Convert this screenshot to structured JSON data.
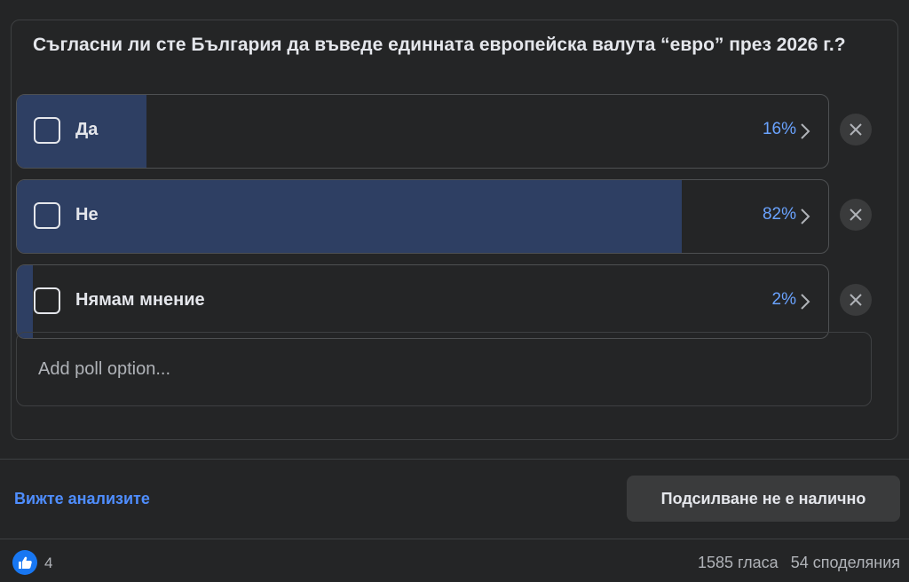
{
  "poll": {
    "question": "Съгласни ли сте България да въведе единната европейска валута “евро” през 2026 г.?",
    "options": [
      {
        "label": "Да",
        "percent_text": "16%",
        "fill_fraction": 0.16
      },
      {
        "label": "Не",
        "percent_text": "82%",
        "fill_fraction": 0.82
      },
      {
        "label": "Нямам мнение",
        "percent_text": "2%",
        "fill_fraction": 0.02
      }
    ],
    "add_option_placeholder": "Add poll option..."
  },
  "footer": {
    "insights_link": "Вижте анализите",
    "boost_button": "Подсилване не е налично",
    "like_count": "4",
    "votes": "1585 гласа",
    "shares": "54 споделяния"
  },
  "colors": {
    "fill": "#2e3f63",
    "percent": "#6aa3ff",
    "link": "#4f8eff",
    "like_badge": "#1877f2"
  }
}
